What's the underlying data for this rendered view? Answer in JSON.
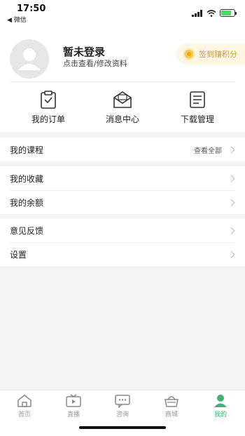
{
  "status_bar": {
    "time": "17:50",
    "back_label": "◀ 微信",
    "battery_level": 0.8
  },
  "profile": {
    "name": "暂未登录",
    "subtitle": "点击查看/修改资料",
    "signin_label": "签到赚积分"
  },
  "quick_actions": [
    {
      "label": "我的订单",
      "icon": "order-clipboard-icon"
    },
    {
      "label": "消息中心",
      "icon": "message-envelope-icon"
    },
    {
      "label": "下载管理",
      "icon": "download-list-icon"
    }
  ],
  "menu": {
    "courses": {
      "label": "我的课程",
      "extra": "查看全部"
    },
    "favorites": {
      "label": "我的收藏"
    },
    "balance": {
      "label": "我的余额"
    },
    "feedback": {
      "label": "意见反馈"
    },
    "settings": {
      "label": "设置"
    }
  },
  "tab_bar": [
    {
      "label": "首页",
      "icon": "home-icon",
      "active": false
    },
    {
      "label": "直播",
      "icon": "tv-icon",
      "active": false
    },
    {
      "label": "咨询",
      "icon": "chat-icon",
      "active": false
    },
    {
      "label": "商城",
      "icon": "basket-icon",
      "active": false
    },
    {
      "label": "我的",
      "icon": "person-icon",
      "active": true
    }
  ],
  "colors": {
    "accent": "#3db27a",
    "signin_text": "#c9a04a",
    "signin_bg": "#fdf6e3"
  }
}
